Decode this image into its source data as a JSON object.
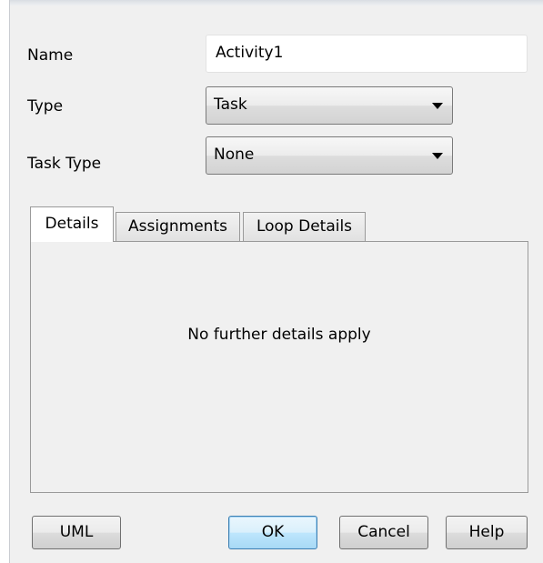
{
  "form": {
    "name_label": "Name",
    "name_value": "Activity1",
    "type_label": "Type",
    "type_value": "Task",
    "task_type_label": "Task Type",
    "task_type_value": "None"
  },
  "tabs": [
    {
      "label": "Details",
      "active": true
    },
    {
      "label": "Assignments",
      "active": false
    },
    {
      "label": "Loop Details",
      "active": false
    }
  ],
  "panel": {
    "message": "No further details apply"
  },
  "buttons": {
    "uml": "UML",
    "ok": "OK",
    "cancel": "Cancel",
    "help": "Help"
  }
}
